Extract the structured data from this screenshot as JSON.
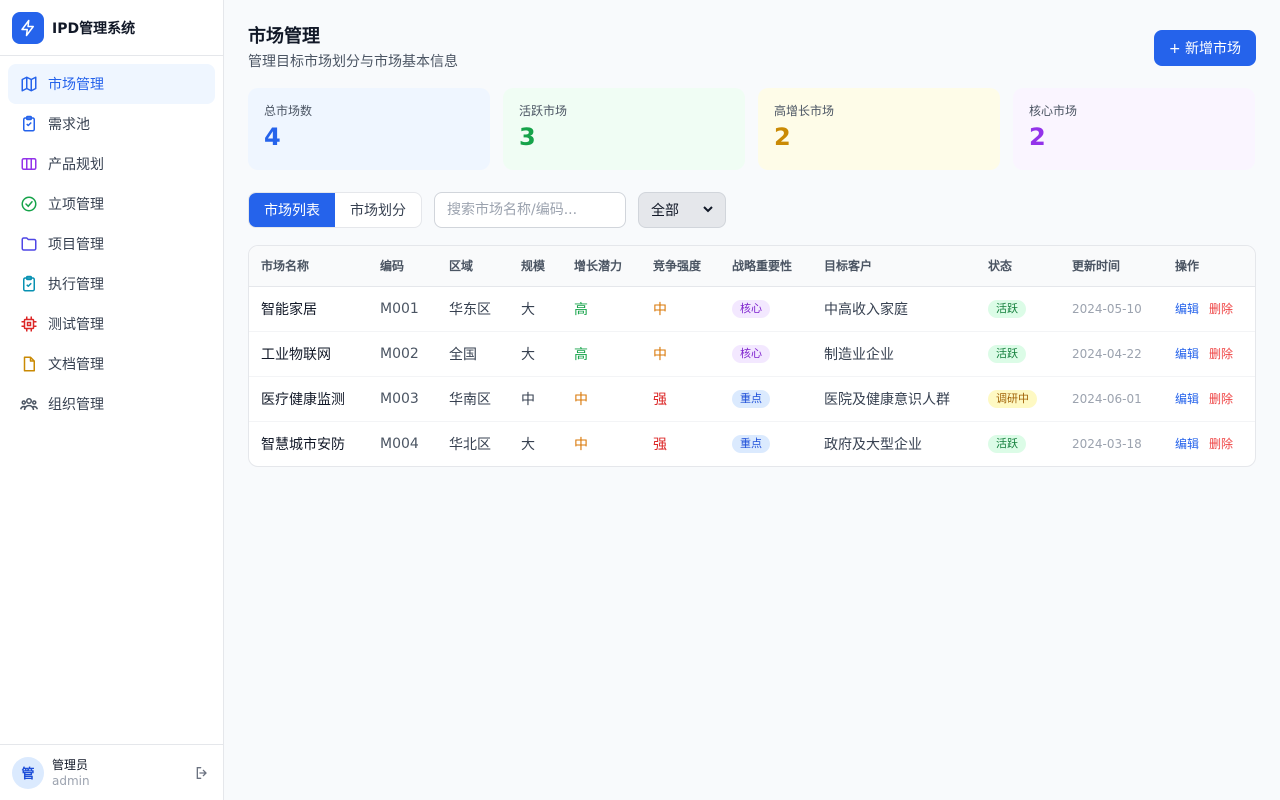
{
  "app": {
    "title": "IPD管理系统"
  },
  "sidebar": {
    "items": [
      {
        "label": "市场管理",
        "icon": "map-icon",
        "active": true
      },
      {
        "label": "需求池",
        "icon": "clipboard-list-icon"
      },
      {
        "label": "产品规划",
        "icon": "columns-icon"
      },
      {
        "label": "立项管理",
        "icon": "check-circle-icon"
      },
      {
        "label": "项目管理",
        "icon": "folder-icon"
      },
      {
        "label": "执行管理",
        "icon": "clipboard-check-icon"
      },
      {
        "label": "测试管理",
        "icon": "chip-icon"
      },
      {
        "label": "文档管理",
        "icon": "file-icon"
      },
      {
        "label": "组织管理",
        "icon": "users-icon"
      }
    ]
  },
  "user": {
    "avatar": "管",
    "name": "管理员",
    "role": "admin"
  },
  "page": {
    "title": "市场管理",
    "subtitle": "管理目标市场划分与市场基本信息",
    "add_button": "+ 新增市场"
  },
  "stats": [
    {
      "label": "总市场数",
      "value": "4",
      "color": "#2563eb",
      "bg": "#eff6ff"
    },
    {
      "label": "活跃市场",
      "value": "3",
      "color": "#16a34a",
      "bg": "#f0fdf4"
    },
    {
      "label": "高增长市场",
      "value": "2",
      "color": "#ca8a04",
      "bg": "#fefce8"
    },
    {
      "label": "核心市场",
      "value": "2",
      "color": "#9333ea",
      "bg": "#faf5ff"
    }
  ],
  "toolbar": {
    "tabs": [
      "市场列表",
      "市场划分"
    ],
    "search_placeholder": "搜索市场名称/编码...",
    "filter_value": "全部"
  },
  "table": {
    "headers": [
      "市场名称",
      "编码",
      "区域",
      "规模",
      "增长潜力",
      "竞争强度",
      "战略重要性",
      "目标客户",
      "状态",
      "更新时间",
      "操作"
    ],
    "rows": [
      {
        "name": "智能家居",
        "code": "M001",
        "region": "华东区",
        "scale": "大",
        "growth": "高",
        "competition": "中",
        "importance": "核心",
        "customer": "中高收入家庭",
        "status": "活跃",
        "updated": "2024-05-10"
      },
      {
        "name": "工业物联网",
        "code": "M002",
        "region": "全国",
        "scale": "大",
        "growth": "高",
        "competition": "中",
        "importance": "核心",
        "customer": "制造业企业",
        "status": "活跃",
        "updated": "2024-04-22"
      },
      {
        "name": "医疗健康监测",
        "code": "M003",
        "region": "华南区",
        "scale": "中",
        "growth": "中",
        "competition": "强",
        "importance": "重点",
        "customer": "医院及健康意识人群",
        "status": "调研中",
        "updated": "2024-06-01"
      },
      {
        "name": "智慧城市安防",
        "code": "M004",
        "region": "华北区",
        "scale": "大",
        "growth": "中",
        "competition": "强",
        "importance": "重点",
        "customer": "政府及大型企业",
        "status": "活跃",
        "updated": "2024-03-18"
      }
    ],
    "actions": {
      "edit": "编辑",
      "delete": "删除"
    }
  }
}
